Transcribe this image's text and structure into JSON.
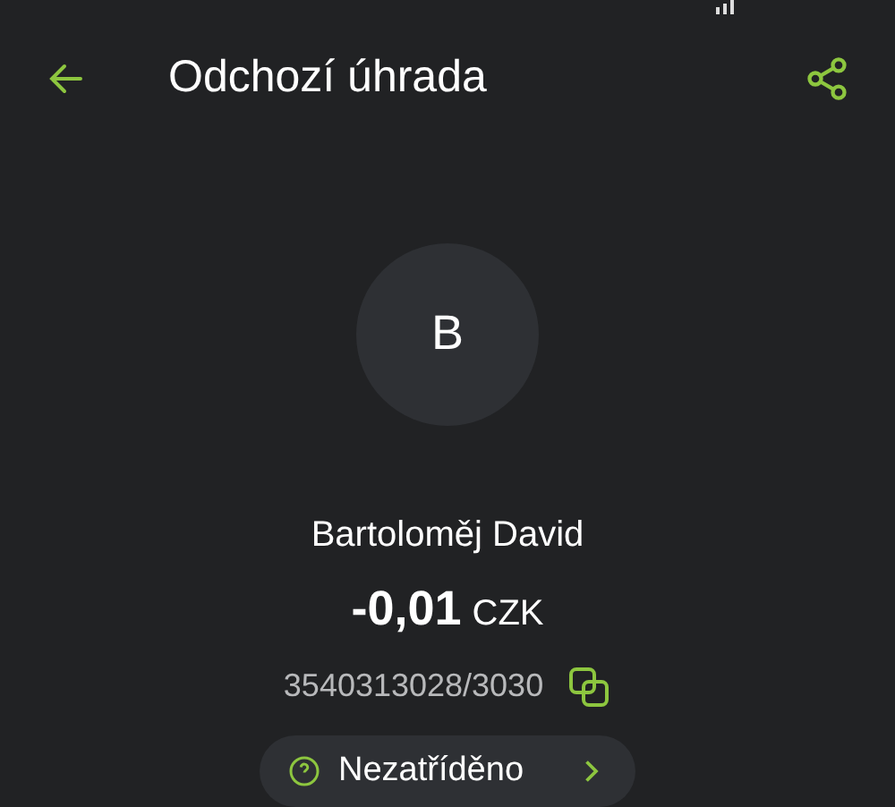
{
  "header": {
    "title": "Odchozí úhrada"
  },
  "counterparty": {
    "initial": "B",
    "name": "Bartoloměj David",
    "amount": "-0,01",
    "currency": "CZK",
    "account": "3540313028/3030"
  },
  "category": {
    "label": "Nezatříděno"
  }
}
